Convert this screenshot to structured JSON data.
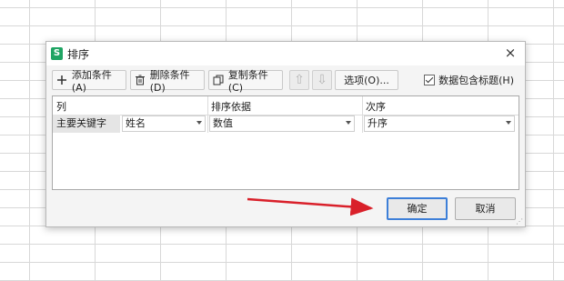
{
  "dialog": {
    "title": "排序",
    "close_label": "×",
    "app_icon_letter": "S"
  },
  "toolbar": {
    "add_label": "添加条件(A)",
    "delete_label": "删除条件(D)",
    "copy_label": "复制条件(C)",
    "options_label": "选项(O)...",
    "header_checkbox_label": "数据包含标题(H)"
  },
  "table": {
    "headers": [
      "列",
      "排序依据",
      "次序"
    ],
    "rows": [
      {
        "label": "主要关键字",
        "column": "姓名",
        "sort_on": "数值",
        "order": "升序"
      }
    ]
  },
  "buttons": {
    "ok": "确定",
    "cancel": "取消"
  },
  "colors": {
    "accent": "#3d7fd8",
    "annotation_arrow": "#d9202a",
    "app_icon": "#1fa463"
  }
}
